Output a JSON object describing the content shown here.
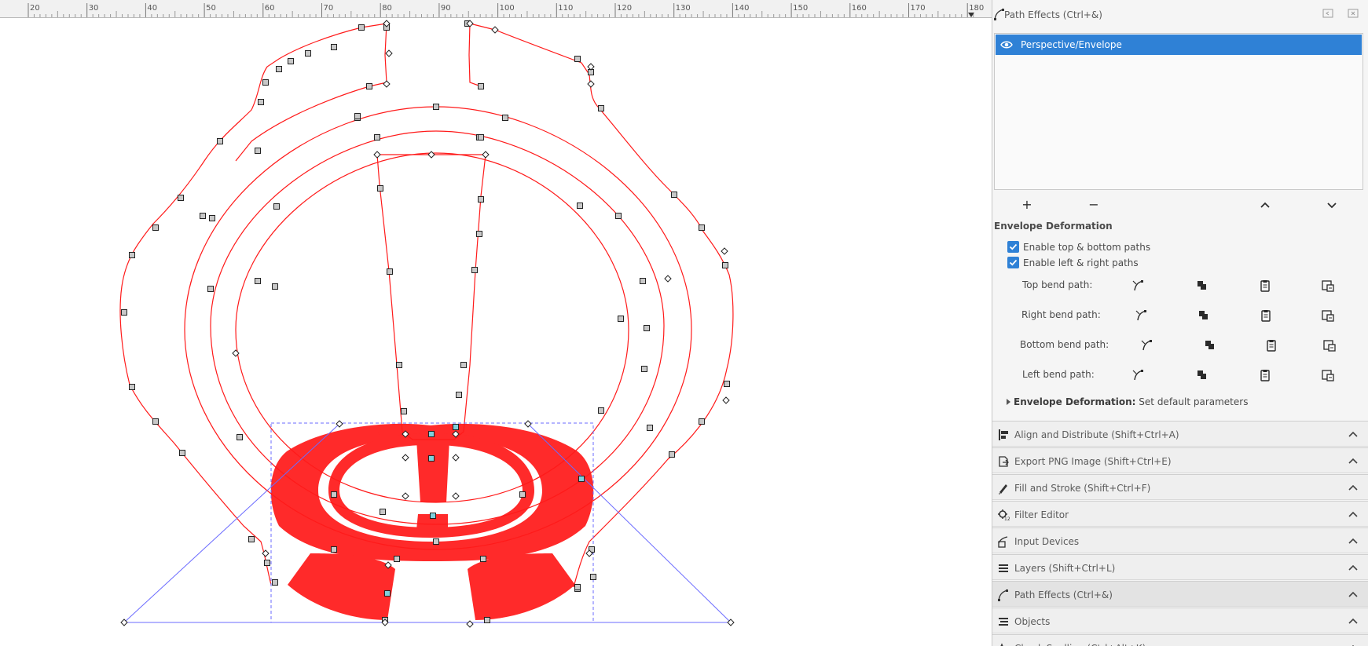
{
  "ruler": {
    "labels": [
      "20",
      "30",
      "40",
      "50",
      "60",
      "70",
      "80",
      "90",
      "100",
      "110",
      "120",
      "130",
      "140",
      "150",
      "160",
      "170",
      "180"
    ]
  },
  "dock": {
    "header_title": "Path Effects (Ctrl+&)",
    "effects": [
      {
        "label": "Perspective/Envelope",
        "selected": true,
        "visible": true
      }
    ],
    "toolbar": {
      "add": "+",
      "remove": "−"
    },
    "section_title": "Envelope Deformation",
    "checkboxes": [
      {
        "label": "Enable top & bottom paths",
        "checked": true
      },
      {
        "label": "Enable left & right paths",
        "checked": true
      }
    ],
    "bend_paths": [
      {
        "label": "Top bend path:"
      },
      {
        "label": "Right bend path:"
      },
      {
        "label": "Bottom bend path:"
      },
      {
        "label": "Left bend path:"
      }
    ],
    "expander": {
      "bold": "Envelope Deformation:",
      "rest": " Set default parameters"
    },
    "dialogs": [
      {
        "label": "Align and Distribute (Shift+Ctrl+A)",
        "icon": "align-icon"
      },
      {
        "label": "Export PNG Image (Shift+Ctrl+E)",
        "icon": "export-icon"
      },
      {
        "label": "Fill and Stroke (Shift+Ctrl+F)",
        "icon": "fill-stroke-icon"
      },
      {
        "label": "Filter Editor",
        "icon": "filter-icon"
      },
      {
        "label": "Input Devices",
        "icon": "input-devices-icon"
      },
      {
        "label": "Layers (Shift+Ctrl+L)",
        "icon": "layers-icon"
      },
      {
        "label": "Path Effects (Ctrl+&)",
        "icon": "path-effects-icon",
        "active": true
      },
      {
        "label": "Objects",
        "icon": "objects-icon"
      },
      {
        "label": "Check Spelling (Ctrl+Alt+K)",
        "icon": "spelling-icon"
      }
    ]
  },
  "colors": {
    "accent": "#2f81d6",
    "shape_fill": "#ff2a2a",
    "path_stroke": "#ff1a1a",
    "envelope": "#6b6bff"
  }
}
